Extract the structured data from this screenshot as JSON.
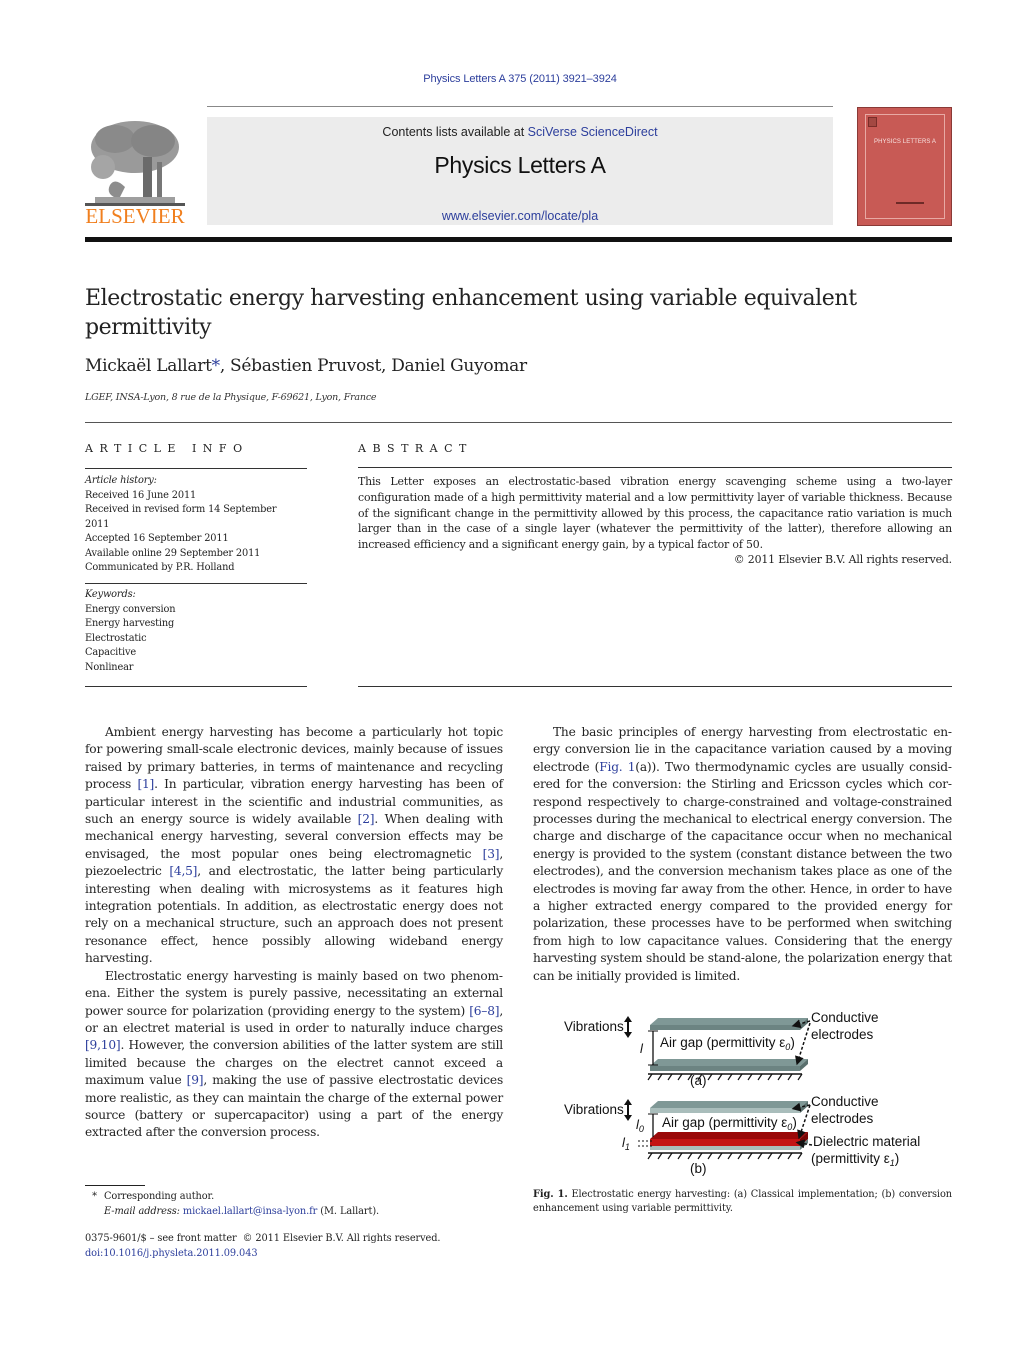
{
  "header": {
    "journal_ref": "Physics Letters A 375 (2011) 3921–3924",
    "contents_prefix": "Contents lists available at ",
    "contents_link": "SciVerse ScienceDirect",
    "journal_name": "Physics Letters A",
    "journal_url": "www.elsevier.com/locate/pla",
    "publisher_logo_text": "ELSEVIER",
    "cover_title": "PHYSICS LETTERS A",
    "colors": {
      "link": "#2c3e9c",
      "elsevier_orange": "#f07f1e",
      "cover": "#c85a55"
    }
  },
  "article": {
    "title": "Electrostatic energy harvesting enhancement using variable equivalent permittivity",
    "authors": [
      {
        "name": "Mickaël Lallart",
        "mark": "*"
      },
      {
        "name": "Sébastien Pruvost",
        "mark": ""
      },
      {
        "name": "Daniel Guyomar",
        "mark": ""
      }
    ],
    "affiliation": "LGEF, INSA-Lyon, 8 rue de la Physique, F-69621, Lyon, France"
  },
  "article_info": {
    "heading": "ARTICLE INFO",
    "history_label": "Article history:",
    "history": [
      "Received 16 June 2011",
      "Received in revised form 14 September 2011",
      "Accepted 16 September 2011",
      "Available online 29 September 2011",
      "Communicated by P.R. Holland"
    ],
    "keywords_label": "Keywords:",
    "keywords": [
      "Energy conversion",
      "Energy harvesting",
      "Electrostatic",
      "Capacitive",
      "Nonlinear"
    ]
  },
  "abstract": {
    "heading": "ABSTRACT",
    "text": "This Letter exposes an electrostatic-based vibration energy scavenging scheme using a two-layer configuration made of a high permittivity material and a low permittivity layer of variable thickness. Because of the significant change in the permittivity allowed by this process, the capacitance ratio variation is much larger than in the case of a single layer (whatever the permittivity of the latter), therefore allowing an increased efficiency and a significant energy gain, by a typical factor of 50.",
    "copyright": "© 2011 Elsevier B.V. All rights reserved."
  },
  "body": {
    "left_paragraphs": [
      [
        {
          "t": "Ambient energy harvesting has become a particularly hot topic for powering small-scale electronic devices, mainly because of is­sues raised by primary batteries, in terms of maintenance and recycling process "
        },
        {
          "ref": "[1]"
        },
        {
          "t": ". In particular, vibration energy harvesting has been of particular interest in the scientific and industrial commu­nities, as such an energy source is widely available "
        },
        {
          "ref": "[2]"
        },
        {
          "t": ". When deal­ing with mechanical energy harvesting, several conversion effects may be envisaged, the most popular ones being electromagnetic "
        },
        {
          "ref": "[3]"
        },
        {
          "t": ", piezoelectric "
        },
        {
          "ref": "[4,5]"
        },
        {
          "t": ", and electrostatic, the latter being partic­ularly interesting when dealing with microsystems as it features high integration potentials. In addition, as electrostatic energy does not rely on a mechanical structure, such an approach does not present resonance effect, hence possibly allowing wideband energy harvesting."
        }
      ],
      [
        {
          "t": "Electrostatic energy harvesting is mainly based on two phenom­ena. Either the system is purely passive, necessitating an external power source for polarization (providing energy to the system) "
        },
        {
          "ref": "[6–8]"
        },
        {
          "t": ", or an electret material is used in order to naturally induce charges "
        },
        {
          "ref": "[9,10]"
        },
        {
          "t": ". However, the conversion abilities of the latter sys­tem are still limited because the charges on the electret cannot exceed a maximum value "
        },
        {
          "ref": "[9]"
        },
        {
          "t": ", making the use of passive electro­static devices more realistic, as they can maintain the charge of the external power source (battery or supercapacitor) using a part of the energy extracted after the conversion process."
        }
      ]
    ],
    "right_paragraphs": [
      [
        {
          "t": "The basic principles of energy harvesting from electrostatic en­ergy conversion lie in the capacitance variation caused by a moving electrode ("
        },
        {
          "ref": "Fig. 1"
        },
        {
          "t": "(a)). Two thermodynamic cycles are usually consid­ered for the conversion: the Stirling and Ericsson cycles which cor­respond respectively to charge-constrained and voltage-constrained processes during the mechanical to electrical energy conversion. The charge and discharge of the capacitance occur when no me­chanical energy is provided to the system (constant distance be­tween the two electrodes), and the conversion mechanism takes place as one of the electrodes is moving far away from the other. Hence, in order to have a higher extracted energy compared to the provided energy for polarization, these processes have to be per­formed when switching from high to low capacitance values. Con­sidering that the energy harvesting system should be stand-alone, the polarization energy that can be initially provided is limited."
        }
      ]
    ]
  },
  "figure": {
    "panel_a": {
      "vibrations": "Vibrations",
      "gap_symbol": "l",
      "air_gap_label": "Air gap (permittivity ε",
      "air_gap_sub": "0",
      "conductive_1": "Conductive",
      "conductive_2": "electrodes",
      "panel_label": "(a)"
    },
    "panel_b": {
      "vibrations": "Vibrations",
      "gap0_symbol": "l",
      "gap0_sub": "0",
      "gap1_symbol": "l",
      "gap1_sub": "1",
      "air_gap_label": "Air gap (permittivity ε",
      "air_gap_sub": "0",
      "conductive_1": "Conductive",
      "conductive_2": "electrodes",
      "dielectric_1": "Dielectric material",
      "dielectric_2": "(permittivity ε",
      "dielectric_sub": "1",
      "panel_label": "(b)"
    },
    "caption_label": "Fig. 1.",
    "caption_text": " Electrostatic energy harvesting: (a) Classical implementation; (b) conversion enhancement using variable permittivity.",
    "colors": {
      "electrode": "#6f8a88",
      "electrode_light": "#a9bdbb",
      "dielectric": "#b80f0f",
      "dielectric_dark": "#8a0606"
    }
  },
  "footnote": {
    "star": "*",
    "corresponding": "Corresponding author.",
    "email_label": "E-mail address:",
    "email": "mickael.lallart@insa-lyon.fr",
    "email_suffix": " (M. Lallart).",
    "issn": "0375-9601/$ – see front matter  © 2011 Elsevier B.V. All rights reserved.",
    "doi": "doi:10.1016/j.physleta.2011.09.043"
  }
}
